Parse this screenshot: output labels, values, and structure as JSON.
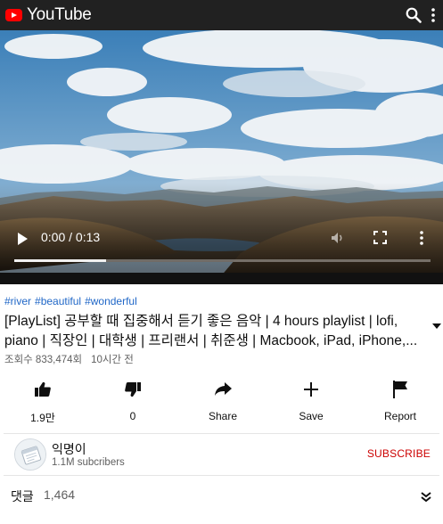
{
  "header": {
    "app_name": "YouTube",
    "search_icon": "search-icon",
    "menu_icon": "more-vert-icon"
  },
  "player": {
    "time": "0:00 / 0:13",
    "progress_fraction": 0.22,
    "icons": [
      "play-icon",
      "volume-icon",
      "fullscreen-icon",
      "more-vert-icon"
    ]
  },
  "video": {
    "hashtags": [
      "#river",
      "#beautiful",
      "#wonderful"
    ],
    "title_line1": "[PlayList] 공부할 때 집중해서 듣기 좋은 음악 | 4 hours playlist | lofi,",
    "title_line2": "piano | 직장인 | 대학생 | 프리랜서 | 취준생 | Macbook, iPad, iPhone,...",
    "views": "조회수 833,474회",
    "uploaded": "10시간 전"
  },
  "actions": {
    "like": "1.9만",
    "dislike": "0",
    "share": "Share",
    "save": "Save",
    "report": "Report"
  },
  "channel": {
    "name": "익명이",
    "subscribers": "1.1M subcribers",
    "subscribe_label": "SUBSCRIBE"
  },
  "comments": {
    "label": "댓글",
    "count": "1,464"
  },
  "colors": {
    "topbar": "#212121",
    "logo_red": "#ff0000",
    "hashtag_blue": "#2067c7",
    "subscribe_red": "#cc0000"
  }
}
